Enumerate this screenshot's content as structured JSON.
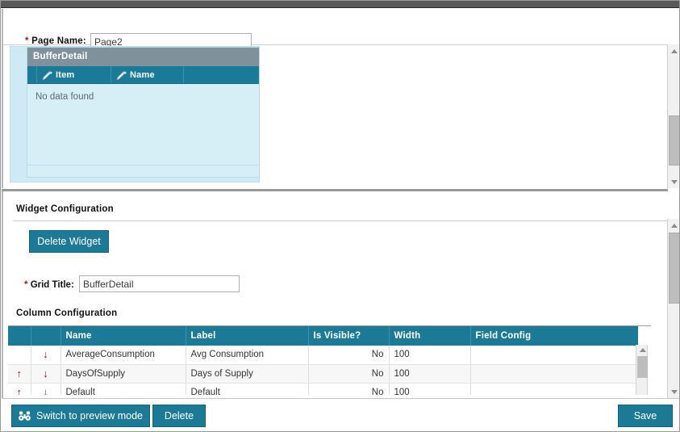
{
  "page_form": {
    "page_name_label": "Page Name:",
    "page_name_value": "Page2",
    "required_marker": "*"
  },
  "design_canvas": {
    "widget": {
      "title": "BufferDetail",
      "columns": [
        {
          "label": "Item",
          "required": true,
          "icon": "pencil-icon"
        },
        {
          "label": "Name",
          "required": true,
          "icon": "pencil-icon"
        }
      ],
      "empty_message": "No data found"
    }
  },
  "widget_configuration": {
    "section_title": "Widget Configuration",
    "delete_widget_label": "Delete Widget",
    "grid_title_label": "Grid Title:",
    "grid_title_value": "BufferDetail",
    "required_marker": "*",
    "column_section_title": "Column Configuration",
    "column_table": {
      "headers": [
        "",
        "",
        "Name",
        "Label",
        "Is Visible?",
        "Width",
        "Field Config"
      ],
      "rows": [
        {
          "move_up": "",
          "move_down": "↓",
          "name": "AverageConsumption",
          "label": "Avg Consumption",
          "is_visible": "No",
          "width": "100",
          "field_config": ""
        },
        {
          "move_up": "↑",
          "move_down": "↓",
          "name": "DaysOfSupply",
          "label": "Days of Supply",
          "is_visible": "No",
          "width": "100",
          "field_config": ""
        },
        {
          "move_up": "↑",
          "move_down": "↓",
          "name": "Default",
          "label": "Default",
          "is_visible": "No",
          "width": "100",
          "field_config": ""
        }
      ]
    }
  },
  "action_bar": {
    "preview_label": "Switch to preview mode",
    "preview_icon": "binoculars-icon",
    "delete_label": "Delete",
    "save_label": "Save"
  },
  "colors": {
    "accent_teal": "#1d7a96",
    "widget_title_gray": "#7f929c",
    "drop_area_blue": "#cfeaf4",
    "grid_body_blue": "#d6eef6",
    "required_red": "#9e1b1b",
    "arrow_red": "#8b1a1a",
    "topbar_gray": "#595959"
  }
}
